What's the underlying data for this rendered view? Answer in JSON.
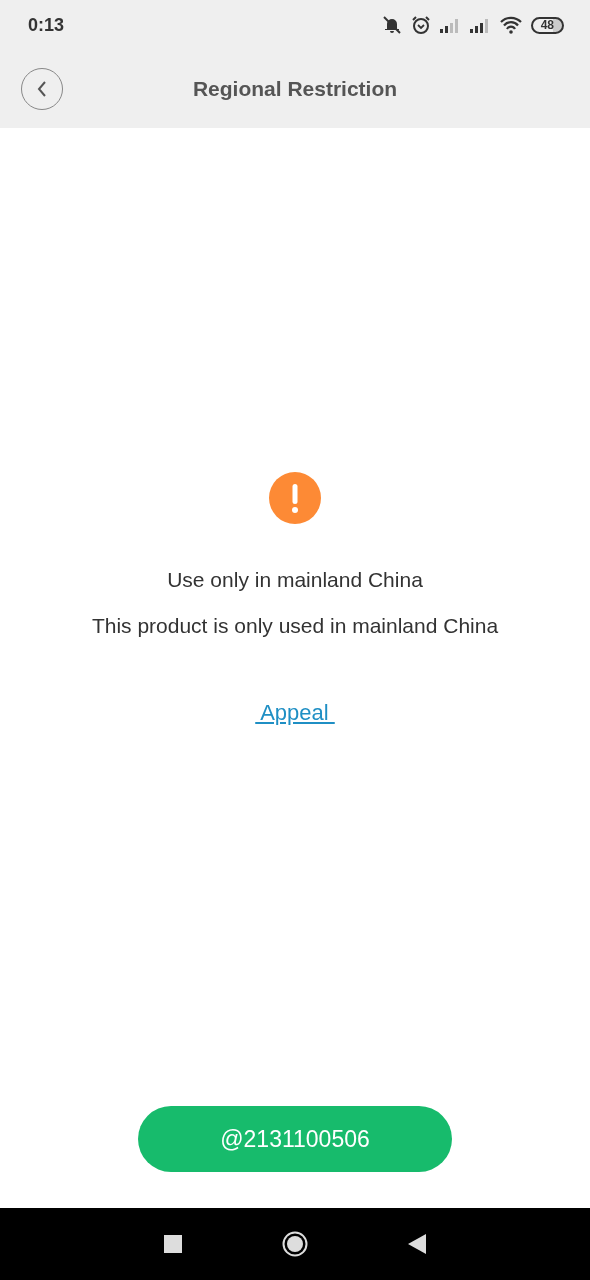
{
  "status_bar": {
    "time": "0:13",
    "battery": "48"
  },
  "header": {
    "title": "Regional Restriction"
  },
  "message": {
    "title": "Use only in mainland China",
    "detail": "This product is only used in mainland China"
  },
  "link": {
    "label": " Appeal "
  },
  "account_button": {
    "label": "@2131100506"
  }
}
